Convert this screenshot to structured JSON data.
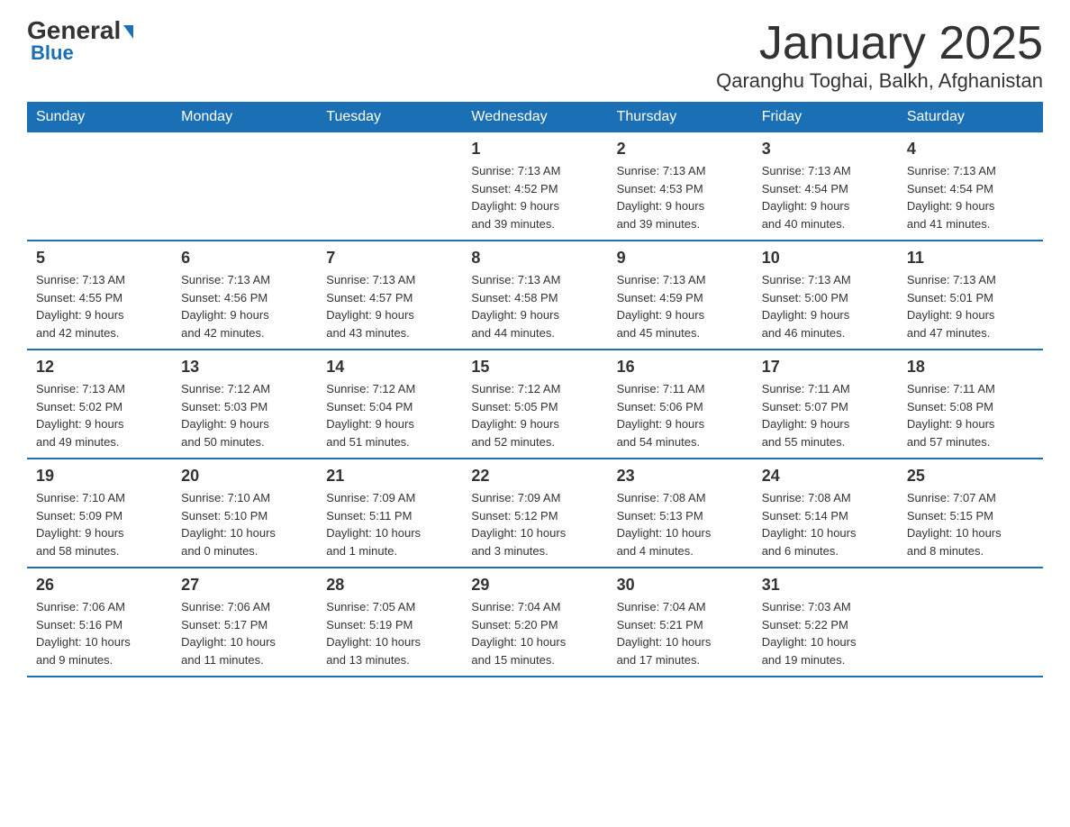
{
  "header": {
    "logo_general": "General",
    "logo_blue": "Blue",
    "month_title": "January 2025",
    "location": "Qaranghu Toghai, Balkh, Afghanistan"
  },
  "days_of_week": [
    "Sunday",
    "Monday",
    "Tuesday",
    "Wednesday",
    "Thursday",
    "Friday",
    "Saturday"
  ],
  "weeks": [
    [
      {
        "day": "",
        "info": ""
      },
      {
        "day": "",
        "info": ""
      },
      {
        "day": "",
        "info": ""
      },
      {
        "day": "1",
        "info": "Sunrise: 7:13 AM\nSunset: 4:52 PM\nDaylight: 9 hours\nand 39 minutes."
      },
      {
        "day": "2",
        "info": "Sunrise: 7:13 AM\nSunset: 4:53 PM\nDaylight: 9 hours\nand 39 minutes."
      },
      {
        "day": "3",
        "info": "Sunrise: 7:13 AM\nSunset: 4:54 PM\nDaylight: 9 hours\nand 40 minutes."
      },
      {
        "day": "4",
        "info": "Sunrise: 7:13 AM\nSunset: 4:54 PM\nDaylight: 9 hours\nand 41 minutes."
      }
    ],
    [
      {
        "day": "5",
        "info": "Sunrise: 7:13 AM\nSunset: 4:55 PM\nDaylight: 9 hours\nand 42 minutes."
      },
      {
        "day": "6",
        "info": "Sunrise: 7:13 AM\nSunset: 4:56 PM\nDaylight: 9 hours\nand 42 minutes."
      },
      {
        "day": "7",
        "info": "Sunrise: 7:13 AM\nSunset: 4:57 PM\nDaylight: 9 hours\nand 43 minutes."
      },
      {
        "day": "8",
        "info": "Sunrise: 7:13 AM\nSunset: 4:58 PM\nDaylight: 9 hours\nand 44 minutes."
      },
      {
        "day": "9",
        "info": "Sunrise: 7:13 AM\nSunset: 4:59 PM\nDaylight: 9 hours\nand 45 minutes."
      },
      {
        "day": "10",
        "info": "Sunrise: 7:13 AM\nSunset: 5:00 PM\nDaylight: 9 hours\nand 46 minutes."
      },
      {
        "day": "11",
        "info": "Sunrise: 7:13 AM\nSunset: 5:01 PM\nDaylight: 9 hours\nand 47 minutes."
      }
    ],
    [
      {
        "day": "12",
        "info": "Sunrise: 7:13 AM\nSunset: 5:02 PM\nDaylight: 9 hours\nand 49 minutes."
      },
      {
        "day": "13",
        "info": "Sunrise: 7:12 AM\nSunset: 5:03 PM\nDaylight: 9 hours\nand 50 minutes."
      },
      {
        "day": "14",
        "info": "Sunrise: 7:12 AM\nSunset: 5:04 PM\nDaylight: 9 hours\nand 51 minutes."
      },
      {
        "day": "15",
        "info": "Sunrise: 7:12 AM\nSunset: 5:05 PM\nDaylight: 9 hours\nand 52 minutes."
      },
      {
        "day": "16",
        "info": "Sunrise: 7:11 AM\nSunset: 5:06 PM\nDaylight: 9 hours\nand 54 minutes."
      },
      {
        "day": "17",
        "info": "Sunrise: 7:11 AM\nSunset: 5:07 PM\nDaylight: 9 hours\nand 55 minutes."
      },
      {
        "day": "18",
        "info": "Sunrise: 7:11 AM\nSunset: 5:08 PM\nDaylight: 9 hours\nand 57 minutes."
      }
    ],
    [
      {
        "day": "19",
        "info": "Sunrise: 7:10 AM\nSunset: 5:09 PM\nDaylight: 9 hours\nand 58 minutes."
      },
      {
        "day": "20",
        "info": "Sunrise: 7:10 AM\nSunset: 5:10 PM\nDaylight: 10 hours\nand 0 minutes."
      },
      {
        "day": "21",
        "info": "Sunrise: 7:09 AM\nSunset: 5:11 PM\nDaylight: 10 hours\nand 1 minute."
      },
      {
        "day": "22",
        "info": "Sunrise: 7:09 AM\nSunset: 5:12 PM\nDaylight: 10 hours\nand 3 minutes."
      },
      {
        "day": "23",
        "info": "Sunrise: 7:08 AM\nSunset: 5:13 PM\nDaylight: 10 hours\nand 4 minutes."
      },
      {
        "day": "24",
        "info": "Sunrise: 7:08 AM\nSunset: 5:14 PM\nDaylight: 10 hours\nand 6 minutes."
      },
      {
        "day": "25",
        "info": "Sunrise: 7:07 AM\nSunset: 5:15 PM\nDaylight: 10 hours\nand 8 minutes."
      }
    ],
    [
      {
        "day": "26",
        "info": "Sunrise: 7:06 AM\nSunset: 5:16 PM\nDaylight: 10 hours\nand 9 minutes."
      },
      {
        "day": "27",
        "info": "Sunrise: 7:06 AM\nSunset: 5:17 PM\nDaylight: 10 hours\nand 11 minutes."
      },
      {
        "day": "28",
        "info": "Sunrise: 7:05 AM\nSunset: 5:19 PM\nDaylight: 10 hours\nand 13 minutes."
      },
      {
        "day": "29",
        "info": "Sunrise: 7:04 AM\nSunset: 5:20 PM\nDaylight: 10 hours\nand 15 minutes."
      },
      {
        "day": "30",
        "info": "Sunrise: 7:04 AM\nSunset: 5:21 PM\nDaylight: 10 hours\nand 17 minutes."
      },
      {
        "day": "31",
        "info": "Sunrise: 7:03 AM\nSunset: 5:22 PM\nDaylight: 10 hours\nand 19 minutes."
      },
      {
        "day": "",
        "info": ""
      }
    ]
  ]
}
